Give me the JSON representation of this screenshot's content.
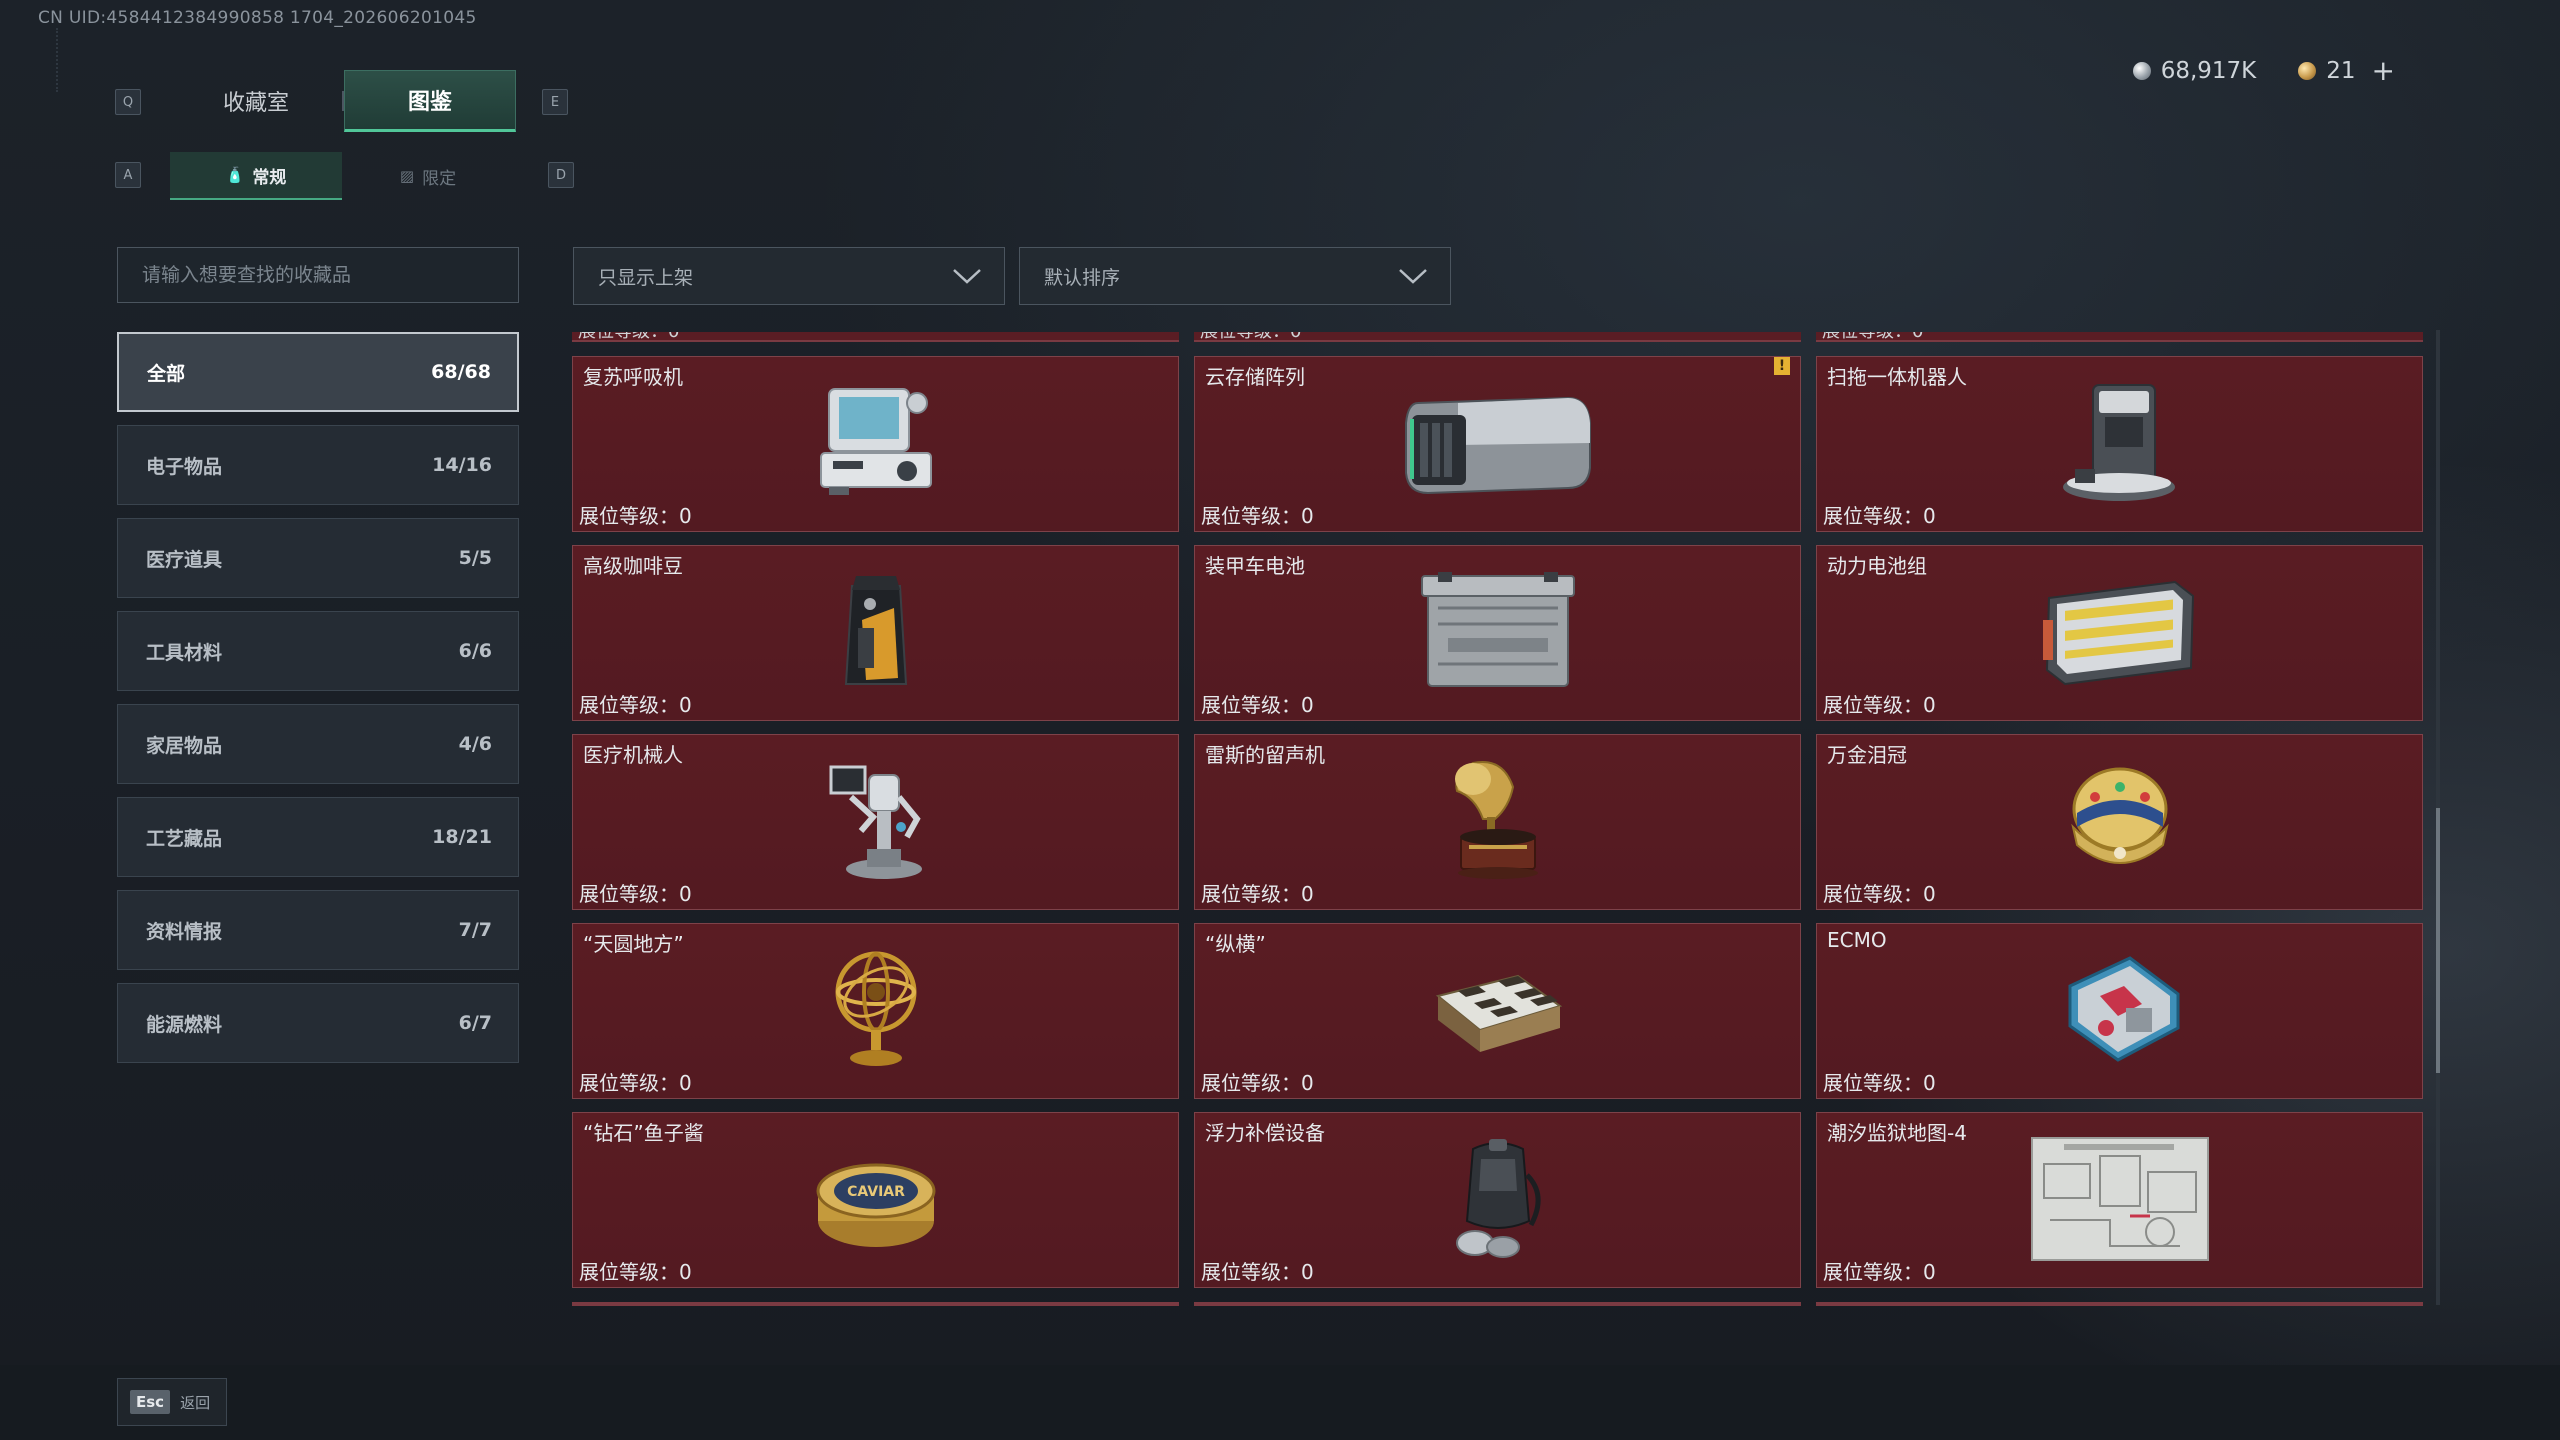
{
  "uid": "CN UID:4584412384990858 1704_202606201045",
  "tabs": {
    "prev_key": "Q",
    "next_key": "E",
    "items": [
      {
        "label": "收藏室",
        "active": false
      },
      {
        "label": "图鉴",
        "active": true
      }
    ]
  },
  "subtabs": {
    "prev_key": "A",
    "next_key": "D",
    "items": [
      {
        "label": "常规",
        "icon": "bottle-icon",
        "active": true
      },
      {
        "label": "限定",
        "icon": "image-icon",
        "active": false
      }
    ]
  },
  "currency": {
    "silver": "68,917K",
    "gold": "21",
    "plus": "+"
  },
  "search": {
    "placeholder": "请输入想要查找的收藏品"
  },
  "filters": {
    "shelf": "只显示上架",
    "sort": "默认排序"
  },
  "categories": [
    {
      "label": "全部",
      "count": "68/68",
      "active": true
    },
    {
      "label": "电子物品",
      "count": "14/16"
    },
    {
      "label": "医疗道具",
      "count": "5/5"
    },
    {
      "label": "工具材料",
      "count": "6/6"
    },
    {
      "label": "家居物品",
      "count": "4/6"
    },
    {
      "label": "工艺藏品",
      "count": "18/21"
    },
    {
      "label": "资料情报",
      "count": "7/7"
    },
    {
      "label": "能源燃料",
      "count": "6/7"
    }
  ],
  "partial_row": [
    "展位等级：0",
    "展位等级：0",
    "展位等级：0"
  ],
  "items": [
    {
      "name": "复苏呼吸机",
      "level": "展位等级：0",
      "icon": "ventilator-icon"
    },
    {
      "name": "云存储阵列",
      "level": "展位等级：0",
      "icon": "storage-array-icon",
      "badge": "!"
    },
    {
      "name": "扫拖一体机器人",
      "level": "展位等级：0",
      "icon": "robot-vacuum-icon"
    },
    {
      "name": "高级咖啡豆",
      "level": "展位等级：0",
      "icon": "coffee-bag-icon"
    },
    {
      "name": "装甲车电池",
      "level": "展位等级：0",
      "icon": "vehicle-battery-icon"
    },
    {
      "name": "动力电池组",
      "level": "展位等级：0",
      "icon": "battery-pack-icon"
    },
    {
      "name": "医疗机械人",
      "level": "展位等级：0",
      "icon": "medical-robot-icon"
    },
    {
      "name": "雷斯的留声机",
      "level": "展位等级：0",
      "icon": "gramophone-icon"
    },
    {
      "name": "万金泪冠",
      "level": "展位等级：0",
      "icon": "jeweled-egg-icon"
    },
    {
      "name": "“天圆地方”",
      "level": "展位等级：0",
      "icon": "armillary-sphere-icon"
    },
    {
      "name": "“纵横”",
      "level": "展位等级：0",
      "icon": "chessboard-icon"
    },
    {
      "name": "ECMO",
      "level": "展位等级：0",
      "icon": "ecmo-machine-icon"
    },
    {
      "name": "“钻石”鱼子酱",
      "level": "展位等级：0",
      "icon": "caviar-tin-icon",
      "art_text": "CAVIAR"
    },
    {
      "name": "浮力补偿设备",
      "level": "展位等级：0",
      "icon": "buoyancy-device-icon"
    },
    {
      "name": "潮汐监狱地图-4",
      "level": "展位等级：0",
      "icon": "map-icon"
    }
  ],
  "footer": {
    "key": "Esc",
    "label": "返回"
  },
  "colors": {
    "accent": "#51c799",
    "card_bg": "#5a1c23",
    "badge": "#e5b232"
  }
}
